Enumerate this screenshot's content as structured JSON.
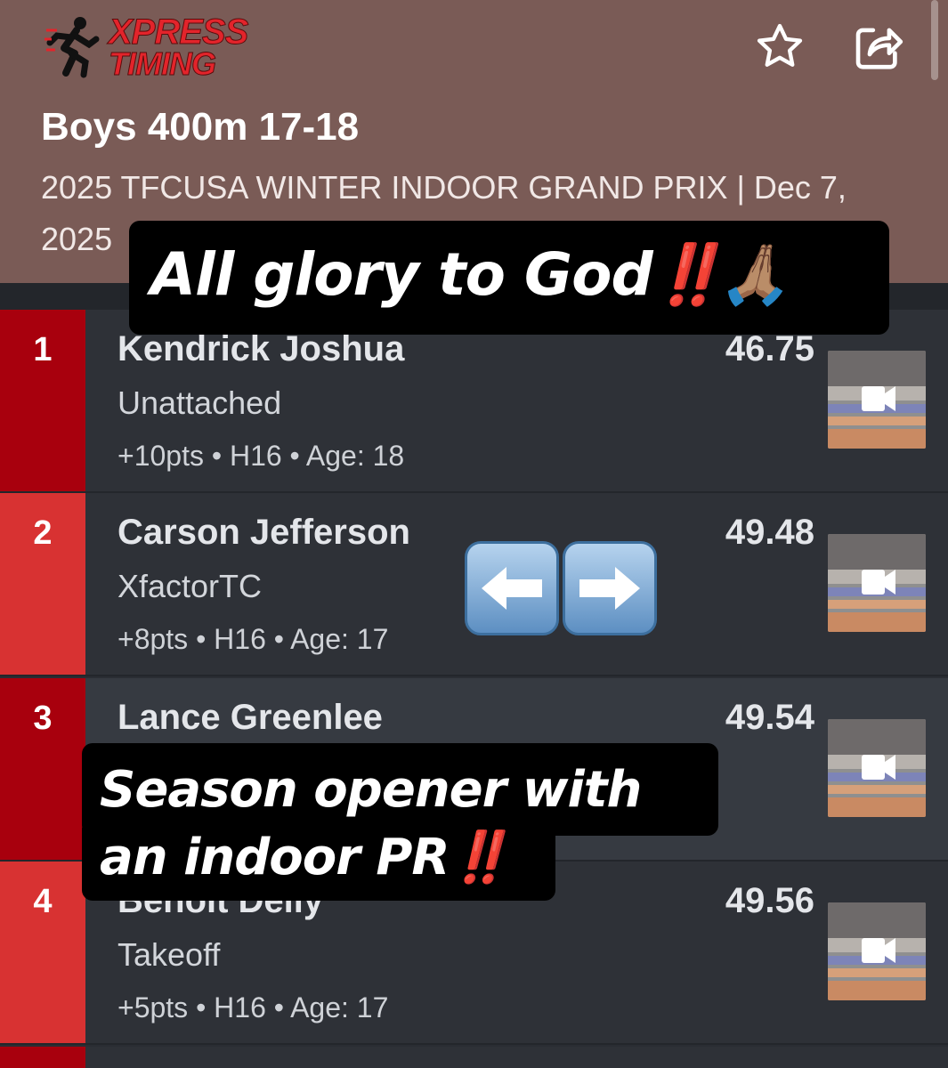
{
  "header": {
    "logo_line1": "XPRESS",
    "logo_line2": "TIMING",
    "event_title": "Boys 400m 17-18",
    "meet_line": "2025 TFCUSA WINTER INDOOR GRAND PRIX | Dec 7, 2025",
    "favorite_icon": "star-icon",
    "share_icon": "share-icon"
  },
  "results": [
    {
      "rank": "1",
      "name": "Kendrick Joshua",
      "team": "Unattached",
      "meta": "+10pts • H16 • Age: 18",
      "mark": "46.75"
    },
    {
      "rank": "2",
      "name": "Carson Jefferson",
      "team": "XfactorTC",
      "meta": "+8pts • H16 • Age: 17",
      "mark": "49.48"
    },
    {
      "rank": "3",
      "name": "Lance Greenlee",
      "team": "",
      "meta": "",
      "mark": "49.54"
    },
    {
      "rank": "4",
      "name": "Benoit Delly",
      "team": "Takeoff",
      "meta": "+5pts • H16 • Age: 17",
      "mark": "49.56"
    }
  ],
  "overlay": {
    "caption_top": "All glory to God",
    "caption_top_emoji": "‼️🙏🏽",
    "caption_bottom_line1": "Season opener with",
    "caption_bottom_line2": "an indoor PR",
    "caption_bottom_emoji": "‼️",
    "arrows_icon": "left-right-arrows-icon"
  },
  "colors": {
    "header_bg": "#7a5b56",
    "rank_red": "#d83232",
    "rank_dark_red": "#a8000d",
    "row_bg": "#2e3137"
  }
}
